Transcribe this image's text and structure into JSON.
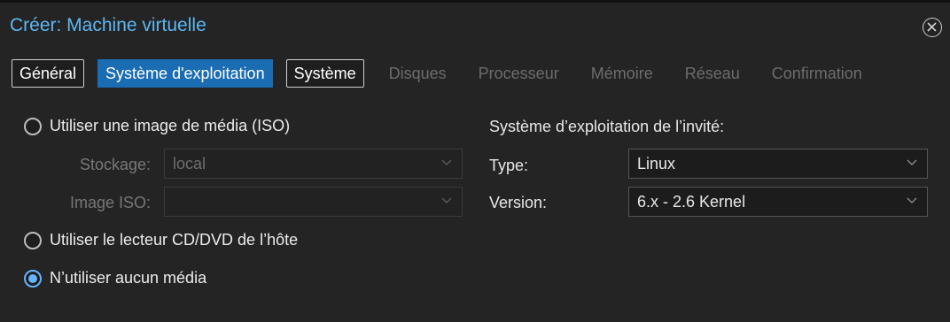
{
  "window": {
    "title": "Créer: Machine virtuelle",
    "close_icon": "close-circle-icon"
  },
  "tabs": [
    {
      "label": "Général",
      "state": "enabled"
    },
    {
      "label": "Système d'exploitation",
      "state": "active"
    },
    {
      "label": "Système",
      "state": "enabled"
    },
    {
      "label": "Disques",
      "state": "disabled"
    },
    {
      "label": "Processeur",
      "state": "disabled"
    },
    {
      "label": "Mémoire",
      "state": "disabled"
    },
    {
      "label": "Réseau",
      "state": "disabled"
    },
    {
      "label": "Confirmation",
      "state": "disabled"
    }
  ],
  "media": {
    "option_iso": {
      "label": "Utiliser une image de média (ISO)",
      "checked": false
    },
    "storage": {
      "label": "Stockage:",
      "value": "local",
      "disabled": true
    },
    "iso_image": {
      "label": "Image ISO:",
      "value": "",
      "disabled": true
    },
    "option_cdrom": {
      "label": "Utiliser le lecteur CD/DVD de l’hôte",
      "checked": false
    },
    "option_none": {
      "label": "N’utiliser aucun média",
      "checked": true
    }
  },
  "guest_os": {
    "title": "Système d’exploitation de l’invité:",
    "type": {
      "label": "Type:",
      "value": "Linux"
    },
    "version": {
      "label": "Version:",
      "value": "6.x - 2.6 Kernel"
    }
  },
  "colors": {
    "accent": "#1b6db3",
    "title": "#5db7f2",
    "radio_checked": "#66b5ff"
  }
}
